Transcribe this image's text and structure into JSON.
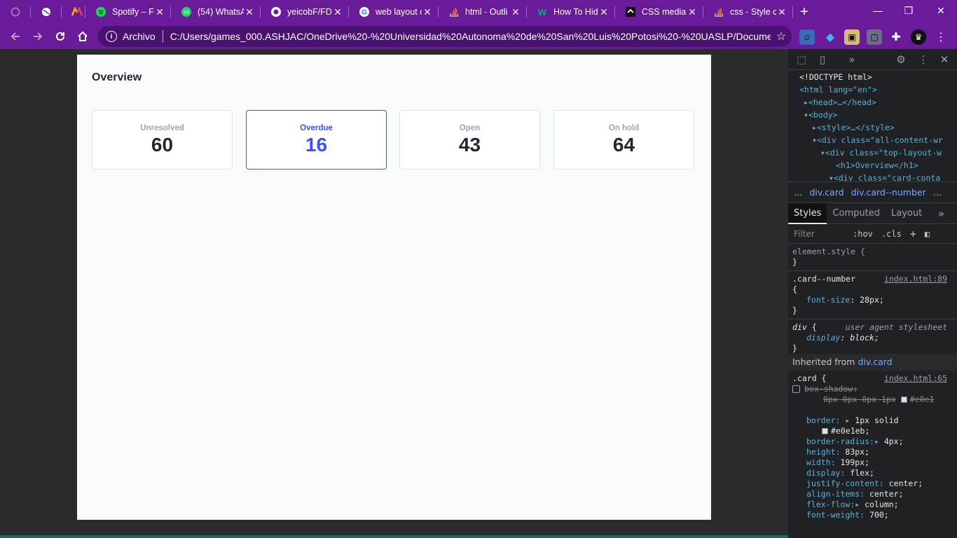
{
  "browser": {
    "tabs": [
      {
        "title": "",
        "icon": "loading-icon"
      },
      {
        "title": "",
        "icon": "globe-icon"
      },
      {
        "title": "",
        "icon": "color-logo-icon"
      },
      {
        "title": "Spotify – FR",
        "icon": "spotify-icon"
      },
      {
        "title": "(54) WhatsA",
        "icon": "whatsapp-icon",
        "badge": "54"
      },
      {
        "title": "yeicobF/FD",
        "icon": "github-icon"
      },
      {
        "title": "web layout c",
        "icon": "google-icon"
      },
      {
        "title": "html - Outli",
        "icon": "stackoverflow-icon"
      },
      {
        "title": "How To Hid",
        "icon": "w3-icon"
      },
      {
        "title": "CSS media c",
        "icon": "mdn-icon"
      },
      {
        "title": "css - Style c",
        "icon": "stackoverflow-icon"
      }
    ],
    "close_glyph": "✕",
    "new_tab_glyph": "+",
    "window": {
      "minimize": "—",
      "maximize": "❐",
      "close": "✕"
    },
    "address": {
      "chip": "Archivo",
      "url": "C:/Users/games_000.ASHJAC/OneDrive%20-%20Universidad%20Autonoma%20de%20San%20Luis%20Potosi%20-%20UASLP/Document..."
    }
  },
  "page": {
    "title": "Overview",
    "cards": [
      {
        "label": "Unresolved",
        "value": "60",
        "selected": false
      },
      {
        "label": "Overdue",
        "value": "16",
        "selected": true
      },
      {
        "label": "Open",
        "value": "43",
        "selected": false
      },
      {
        "label": "On hold",
        "value": "64",
        "selected": false
      }
    ]
  },
  "devtools": {
    "dom": {
      "doctype": "<!DOCTYPE html>",
      "html": "<html lang=\"en\">",
      "head": "<head>…</head>",
      "body": "<body>",
      "style": "<style>…</style>",
      "div1": "<div class=\"all-content-wr",
      "div2": "<div class=\"top-layout-w",
      "h1": "<h1>Overview</h1>",
      "div3": "<div class=\"card-conta"
    },
    "breadcrumbs": [
      "…",
      "div.card",
      "div.card--number",
      "…"
    ],
    "tabs": [
      "Styles",
      "Computed",
      "Layout"
    ],
    "filter_placeholder": "Filter",
    "filter_hov": ":hov",
    "filter_cls": ".cls",
    "rules": {
      "element_style": "element.style {",
      "close": "}",
      "open": "{",
      "r1_selector": ".card--number",
      "r1_source": "index.html:89",
      "r1_prop": "font-size",
      "r1_val": "28px;",
      "r2_selector": "div",
      "r2_source": "user agent stylesheet",
      "r2_prop": "display",
      "r2_val": "block;",
      "inherited_label": "Inherited from",
      "inherited_from": "div.card",
      "r3_selector": ".card {",
      "r3_source": "index.html:65",
      "r3_shadow_prop": "box-shadow:",
      "r3_shadow_val": "0px 0px 0px 1px",
      "r3_shadow_color": "#e0e1",
      "r3_border": "border:",
      "r3_border_val": "1px solid",
      "r3_border_color": "#e0e1eb;",
      "r3_radius": "border-radius:",
      "r3_radius_val": "4px;",
      "r3_height": "height:",
      "r3_height_val": "83px;",
      "r3_width": "width:",
      "r3_width_val": "199px;",
      "r3_display": "display:",
      "r3_display_val": "flex;",
      "r3_jc": "justify-content:",
      "r3_jc_val": "center;",
      "r3_ai": "align-items:",
      "r3_ai_val": "center;",
      "r3_ff": "flex-flow:",
      "r3_ff_val": "column;",
      "r3_fw": "font-weight:",
      "r3_fw_val": "700;"
    }
  },
  "colors": {
    "accent": "#3751ff",
    "text": "#252733",
    "muted": "#9fa2b4",
    "border": "#e0e1eb",
    "chrome": "#6a1b9a"
  }
}
